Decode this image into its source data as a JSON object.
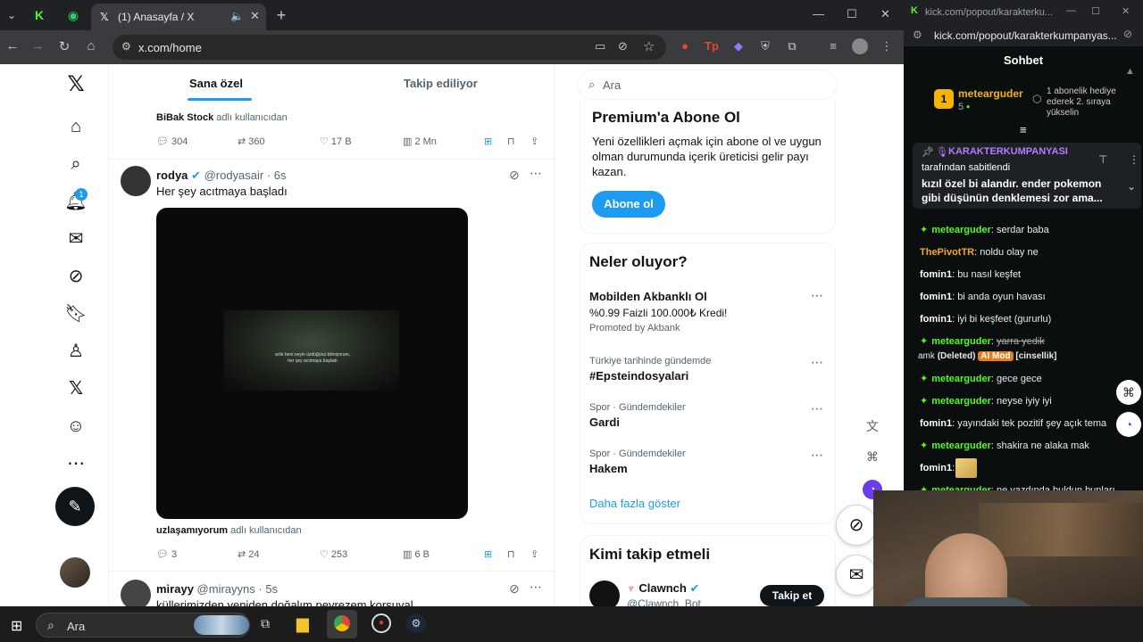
{
  "browser_left": {
    "tab_title": "(1) Anasayfa / X",
    "url": "x.com/home"
  },
  "x": {
    "notif_count": "1",
    "tabs": {
      "for_you": "Sana özel",
      "following": "Takip ediliyor"
    },
    "search_placeholder": "Ara",
    "prev_tweet": {
      "attribution_user": "BiBak Stock",
      "attribution_suffix": "adlı kullanıcıdan",
      "replies": "304",
      "retweets": "360",
      "likes": "17 B",
      "views": "2 Mn"
    },
    "tweet": {
      "name": "rodya",
      "handle": "@rodyasair",
      "time": "· 6s",
      "text": "Her şey acıtmaya başladı",
      "video_caption": "artık beni neyin üzdüğünü bilmiyorum, her şey acıtmaya başladı",
      "attribution_user": "uzlaşamıyorum",
      "attribution_suffix": "adlı kullanıcıdan",
      "replies": "3",
      "retweets": "24",
      "likes": "253",
      "views": "6 B"
    },
    "next_tweet": {
      "name": "mirayy",
      "handle": "@mirayyns",
      "time": "· 5s",
      "text": "küllerimizden yeniden doğalım peyrezem korsuyal"
    },
    "premium": {
      "title": "Premium'a Abone Ol",
      "body": "Yeni özellikleri açmak için abone ol ve uygun olman durumunda içerik üreticisi gelir payı kazan.",
      "button": "Abone ol"
    },
    "trends": {
      "title": "Neler oluyor?",
      "promo": {
        "title": "Mobilden Akbanklı Ol",
        "sub": "%0.99 Faizli 100.000₺ Kredi!",
        "promoted": "Promoted by Akbank"
      },
      "items": [
        {
          "meta": "Türkiye tarihinde gündemde",
          "title": "#Epsteindosyalari"
        },
        {
          "meta": "Spor · Gündemdekiler",
          "title": "Gardi"
        },
        {
          "meta": "Spor · Gündemdekiler",
          "title": "Hakem"
        }
      ],
      "show_more": "Daha fazla göster"
    },
    "who_to_follow": {
      "title": "Kimi takip etmeli",
      "name": "Clawnch",
      "handle": "@Clawnch_Bot",
      "follow": "Takip et"
    }
  },
  "kick": {
    "window_title": "kick.com/popout/karakterku...",
    "url": "kick.com/popout/karakterkumpanyas...",
    "chat_title": "Sohbet",
    "top_user": {
      "name": "metearguder",
      "count": "5"
    },
    "gift_text": "1 abonelik hediye ederek 2. sıraya yükselin",
    "pinned": {
      "channel": "KARAKTERKUMPANYASI",
      "by": "tarafından sabitlendi",
      "text": "kızıl özel bi alandır. ender pokemon gibi düşünün denklemesi zor ama..."
    },
    "messages": [
      {
        "user": "metearguder",
        "text": "serdar baba",
        "color": "#53fc18",
        "star": true
      },
      {
        "user": "ThePivotTR",
        "text": "noldu olay ne",
        "color": "#f5a623",
        "star": false
      },
      {
        "user": "fomin1",
        "text": "bu nasıl keşfet",
        "color": "#ffffff",
        "star": false
      },
      {
        "user": "fomin1",
        "text": "bi anda oyun havası",
        "color": "#ffffff",
        "star": false
      },
      {
        "user": "fomin1",
        "text": "iyi bi keşfeet (gururlu)",
        "color": "#ffffff",
        "star": false
      },
      {
        "user": "metearguder",
        "text": "yarra yedik",
        "color": "#53fc18",
        "star": true,
        "deleted": true
      },
      {
        "user": "metearguder",
        "text": "gece gece",
        "color": "#53fc18",
        "star": true
      },
      {
        "user": "metearguder",
        "text": "neyse iyiy iyi",
        "color": "#53fc18",
        "star": true
      },
      {
        "user": "fomin1",
        "text": "yayındaki tek pozitif şey açık tema",
        "color": "#ffffff",
        "star": false
      },
      {
        "user": "metearguder",
        "text": "shakira ne alaka mak",
        "color": "#53fc18",
        "star": true
      },
      {
        "user": "fomin1",
        "text": "",
        "color": "#ffffff",
        "star": false
      },
      {
        "user": "metearguder",
        "text": "ne yazdında buldun bunları",
        "color": "#53fc18",
        "star": true
      }
    ],
    "deleted_line": {
      "prefix": "amk",
      "deleted": "(Deleted)",
      "badge": "AI Mod",
      "tag": "[cinsellik]"
    }
  },
  "taskbar": {
    "search": "Ara"
  },
  "colors": {
    "x_blue": "#1d9bf0",
    "kick_green": "#53fc18"
  }
}
